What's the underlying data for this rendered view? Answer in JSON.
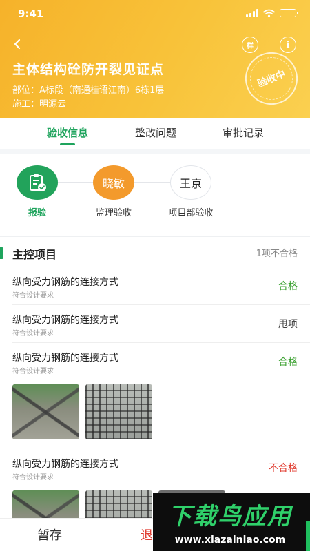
{
  "status_bar": {
    "time": "9:41"
  },
  "header": {
    "title": "主体结构砼防开裂见证点",
    "location_line": "部位：A标段（南通桂语江南）6栋1层",
    "builder_line": "施工：明源云",
    "sample_label": "样",
    "info_label": "i",
    "stamp_text": "验收中"
  },
  "tabs": [
    {
      "label": "验收信息",
      "active": true
    },
    {
      "label": "整改问题",
      "active": false
    },
    {
      "label": "审批记录",
      "active": false
    }
  ],
  "flow": {
    "nodes": [
      {
        "name": "",
        "label": "报验",
        "icon": "clipboard-check-icon",
        "color": "#22a35b"
      },
      {
        "name": "晓敏",
        "label": "监理验收",
        "color": "#f39a2c"
      },
      {
        "name": "王京",
        "label": "项目部验收",
        "color": "#ffffff"
      }
    ]
  },
  "section": {
    "title": "主控项目",
    "summary": "1项不合格",
    "accent": "#1fa45d"
  },
  "items": [
    {
      "title": "纵向受力钢筋的连接方式",
      "subtitle": "符合设计要求",
      "status": "合格"
    },
    {
      "title": "纵向受力钢筋的连接方式",
      "subtitle": "符合设计要求",
      "status": "甩项"
    },
    {
      "title": "纵向受力钢筋的连接方式",
      "subtitle": "符合设计要求",
      "status": "合格",
      "photos": 2
    },
    {
      "title": "纵向受力钢筋的连接方式",
      "subtitle": "符合设计要求",
      "status": "不合格",
      "photos": 3
    }
  ],
  "status_colors": {
    "pass": "#3ca232",
    "fail": "#e03a2e"
  },
  "bottom_bar": {
    "save_label": "暂存",
    "return_label": "退"
  },
  "watermark": {
    "title": "下载鸟应用",
    "url": "www.xiazainiao.com"
  }
}
